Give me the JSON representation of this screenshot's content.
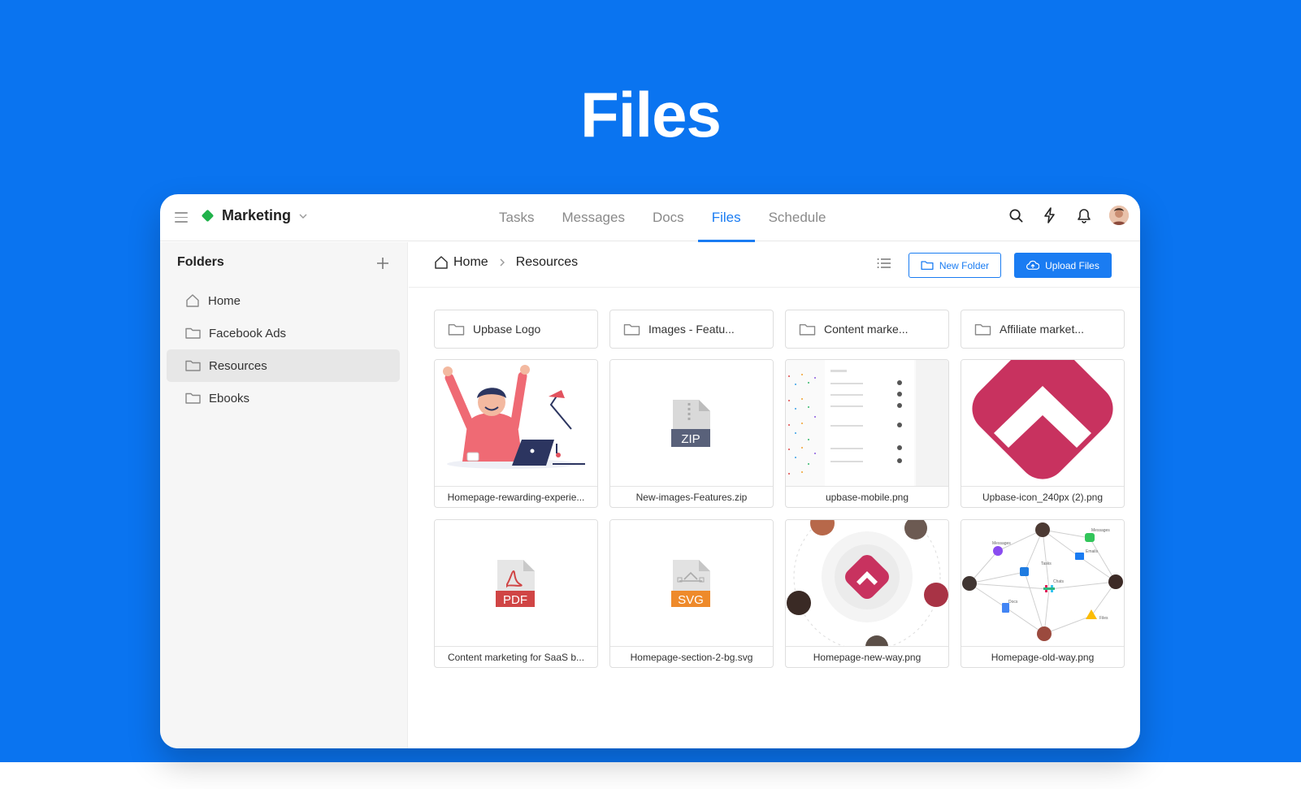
{
  "hero": {
    "title": "Files"
  },
  "workspace": {
    "name": "Marketing"
  },
  "tabs": [
    {
      "label": "Tasks"
    },
    {
      "label": "Messages"
    },
    {
      "label": "Docs"
    },
    {
      "label": "Files",
      "active": true
    },
    {
      "label": "Schedule"
    }
  ],
  "sidebar": {
    "title": "Folders",
    "items": [
      {
        "label": "Home",
        "icon": "home-icon"
      },
      {
        "label": "Facebook Ads",
        "icon": "folder-icon"
      },
      {
        "label": "Resources",
        "icon": "folder-icon",
        "active": true
      },
      {
        "label": "Ebooks",
        "icon": "folder-icon"
      }
    ]
  },
  "breadcrumb": {
    "home": "Home",
    "current": "Resources"
  },
  "buttons": {
    "new_folder": "New Folder",
    "upload": "Upload Files"
  },
  "folders": [
    {
      "name": "Upbase Logo"
    },
    {
      "name": "Images - Featu..."
    },
    {
      "name": "Content marke..."
    },
    {
      "name": "Affiliate market..."
    }
  ],
  "files": [
    {
      "name": "Homepage-rewarding-experie...",
      "thumb": "illustration"
    },
    {
      "name": "New-images-Features.zip",
      "thumb": "zip",
      "badge": "ZIP"
    },
    {
      "name": "upbase-mobile.png",
      "thumb": "mobile"
    },
    {
      "name": "Upbase-icon_240px (2).png",
      "thumb": "logo"
    },
    {
      "name": "Content marketing for SaaS b...",
      "thumb": "pdf",
      "badge": "PDF"
    },
    {
      "name": "Homepage-section-2-bg.svg",
      "thumb": "svg",
      "badge": "SVG"
    },
    {
      "name": "Homepage-new-way.png",
      "thumb": "newway"
    },
    {
      "name": "Homepage-old-way.png",
      "thumb": "oldway"
    }
  ],
  "colors": {
    "brand_blue": "#0a74f0",
    "accent": "#1a7cf2",
    "logo_pink": "#c8325f",
    "workspace_green": "#21b24b"
  }
}
